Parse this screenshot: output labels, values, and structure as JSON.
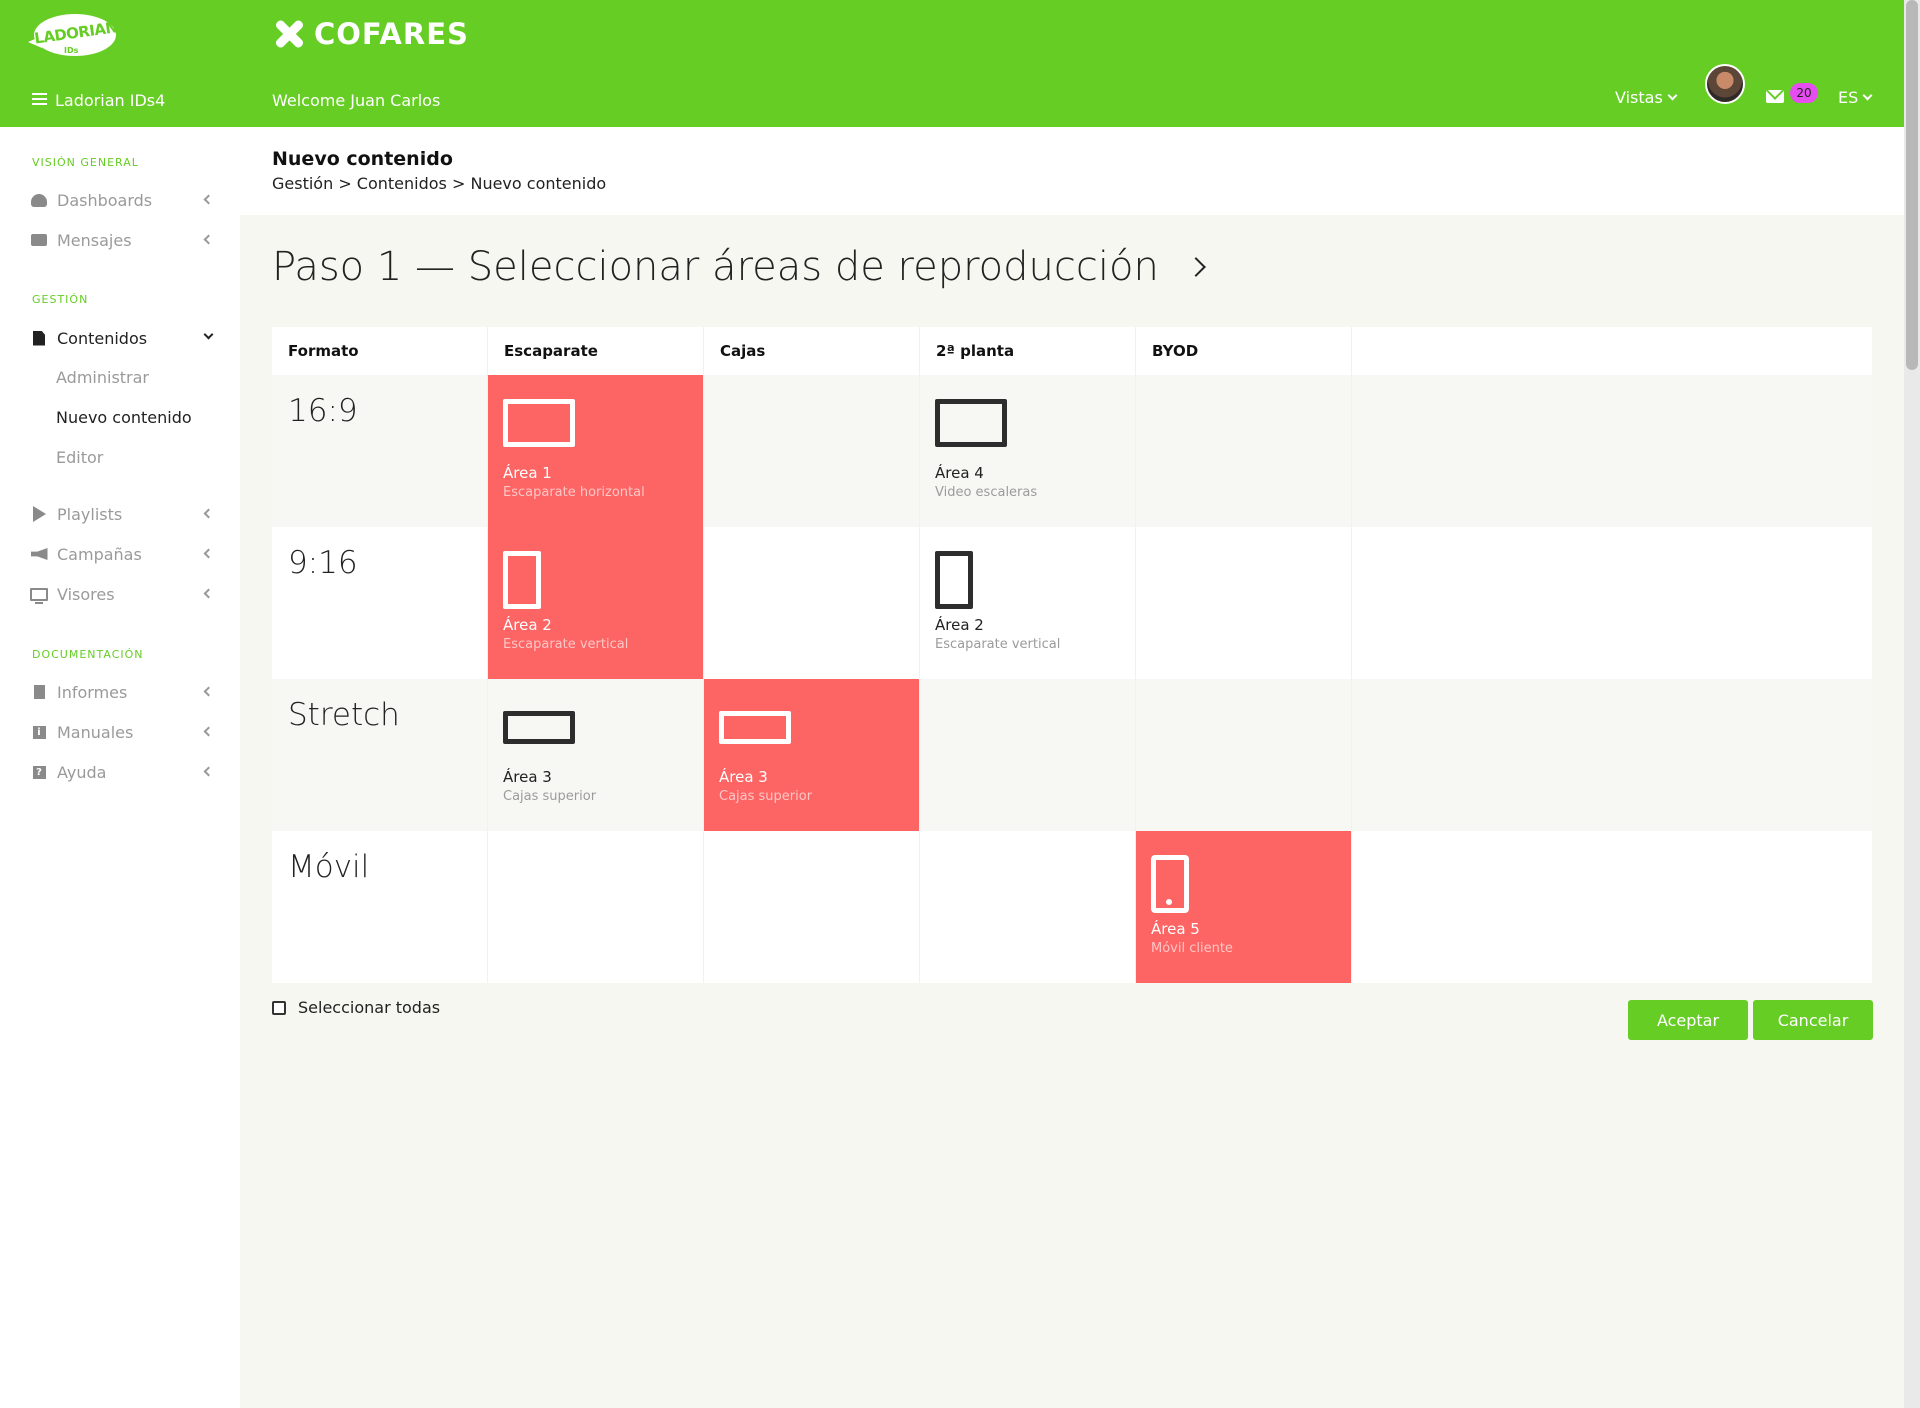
{
  "header": {
    "logo_text": "LADORIAN",
    "logo_sub": "IDs",
    "app_name": "Ladorian IDs4",
    "brand": "COFARES",
    "welcome": "Welcome Juan Carlos",
    "vistas": "Vistas",
    "messages_count": "20",
    "language": "ES",
    "accent_color": "#65cd24"
  },
  "sidebar": {
    "sections": [
      {
        "title": "VISIÓN GENERAL"
      },
      {
        "title": "GESTIÓN"
      },
      {
        "title": "DOCUMENTACIÓN"
      }
    ],
    "items": [
      {
        "label": "Dashboards",
        "icon": "dashboard-icon"
      },
      {
        "label": "Mensajes",
        "icon": "envelope-icon"
      },
      {
        "label": "Contenidos",
        "icon": "file-icon"
      },
      {
        "label": "Playlists",
        "icon": "play-icon"
      },
      {
        "label": "Campañas",
        "icon": "megaphone-icon"
      },
      {
        "label": "Visores",
        "icon": "monitor-icon"
      },
      {
        "label": "Informes",
        "icon": "file-text-icon"
      },
      {
        "label": "Manuales",
        "icon": "info-icon"
      },
      {
        "label": "Ayuda",
        "icon": "help-icon"
      }
    ],
    "contenidos_sub": [
      "Administrar",
      "Nuevo contenido",
      "Editor"
    ]
  },
  "page": {
    "title": "Nuevo contenido",
    "breadcrumb": "Gestión > Contenidos > Nuevo contenido",
    "step_title": "Paso 1 — Seleccionar áreas de reproducción"
  },
  "grid": {
    "columns": [
      "Formato",
      "Escaparate",
      "Cajas",
      "2ª planta",
      "BYOD"
    ],
    "rows": [
      {
        "format": "16:9"
      },
      {
        "format": "9:16"
      },
      {
        "format": "Stretch"
      },
      {
        "format": "Móvil"
      }
    ],
    "areas": {
      "r1_escaparate": {
        "label": "Área 1",
        "sub": "Escaparate horizontal",
        "selected": true
      },
      "r1_planta": {
        "label": "Área 4",
        "sub": "Video escaleras",
        "selected": false
      },
      "r2_escaparate": {
        "label": "Área 2",
        "sub": "Escaparate vertical",
        "selected": true
      },
      "r2_planta": {
        "label": "Área 2",
        "sub": "Escaparate vertical",
        "selected": false
      },
      "r3_escaparate": {
        "label": "Área 3",
        "sub": "Cajas superior",
        "selected": false
      },
      "r3_cajas": {
        "label": "Área 3",
        "sub": "Cajas superior",
        "selected": true
      },
      "r4_byod": {
        "label": "Área 5",
        "sub": "Móvil cliente",
        "selected": true
      }
    },
    "selected_color": "#fd6464"
  },
  "actions": {
    "select_all": "Seleccionar todas",
    "accept": "Aceptar",
    "cancel": "Cancelar"
  }
}
